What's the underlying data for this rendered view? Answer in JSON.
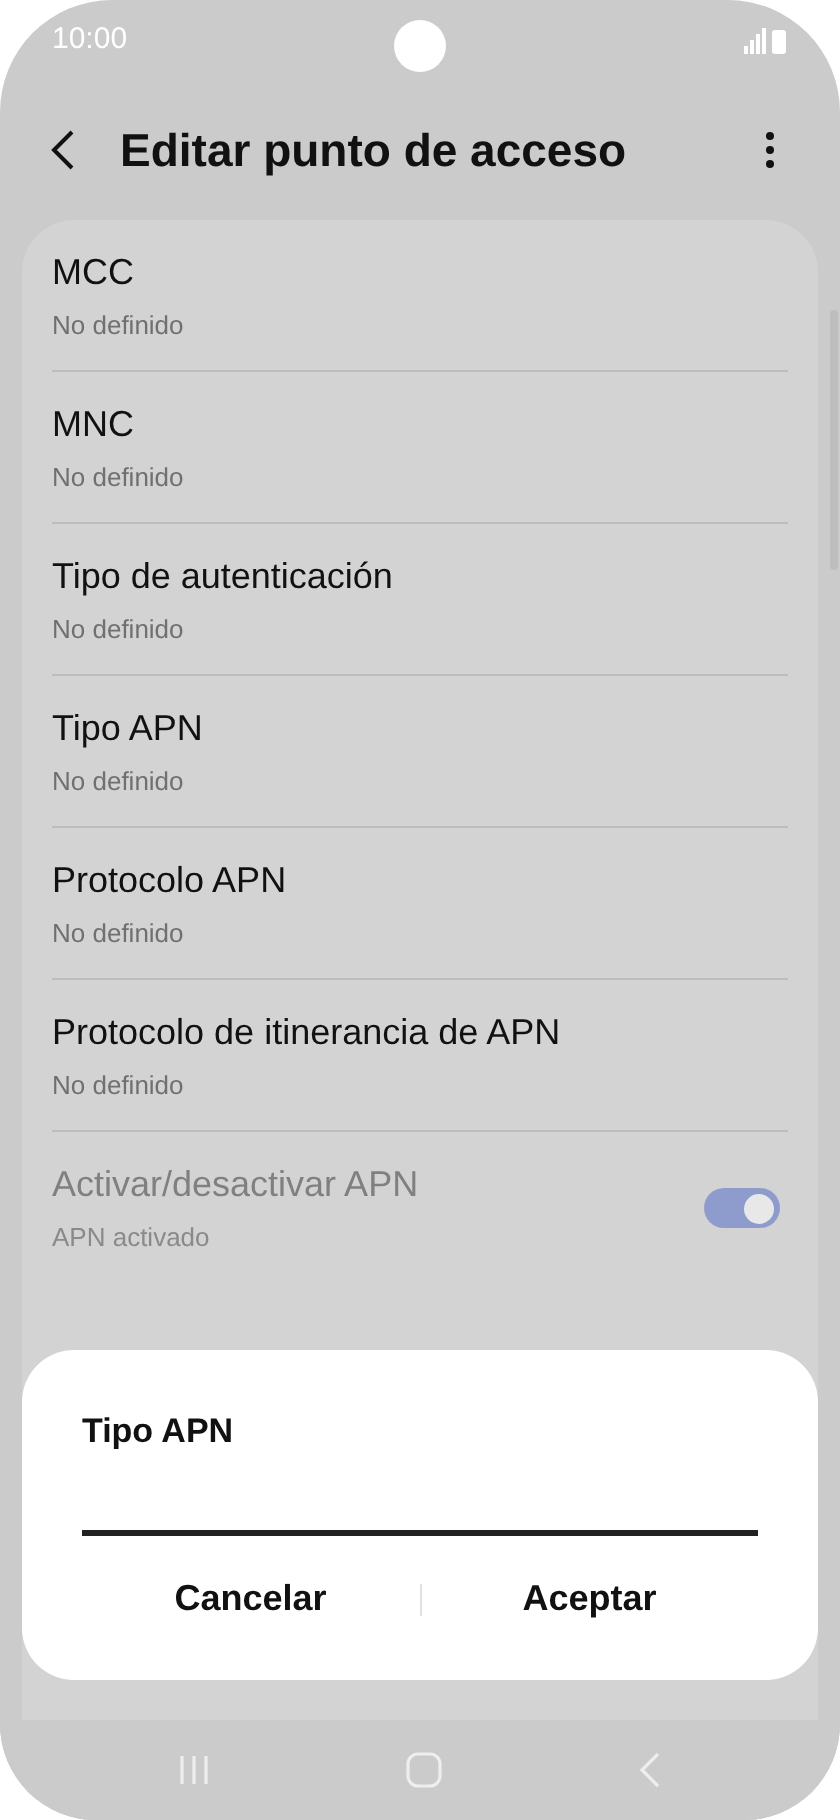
{
  "status_bar": {
    "time": "10:00"
  },
  "header": {
    "title": "Editar punto de acceso"
  },
  "items": [
    {
      "kind": "text",
      "title": "MCC",
      "subtitle": "No definido",
      "disabled": false
    },
    {
      "kind": "text",
      "title": "MNC",
      "subtitle": "No definido",
      "disabled": false
    },
    {
      "kind": "text",
      "title": "Tipo de autenticación",
      "subtitle": "No definido",
      "disabled": false
    },
    {
      "kind": "text",
      "title": "Tipo APN",
      "subtitle": "No definido",
      "disabled": false
    },
    {
      "kind": "text",
      "title": "Protocolo APN",
      "subtitle": "No definido",
      "disabled": false
    },
    {
      "kind": "text",
      "title": "Protocolo de itinerancia de APN",
      "subtitle": "No definido",
      "disabled": false
    },
    {
      "kind": "switch",
      "title": "Activar/desactivar APN",
      "subtitle": "APN activado",
      "disabled": true,
      "on": true
    }
  ],
  "dialog": {
    "title": "Tipo APN",
    "buttons": [
      "Cancelar",
      "Aceptar"
    ]
  }
}
